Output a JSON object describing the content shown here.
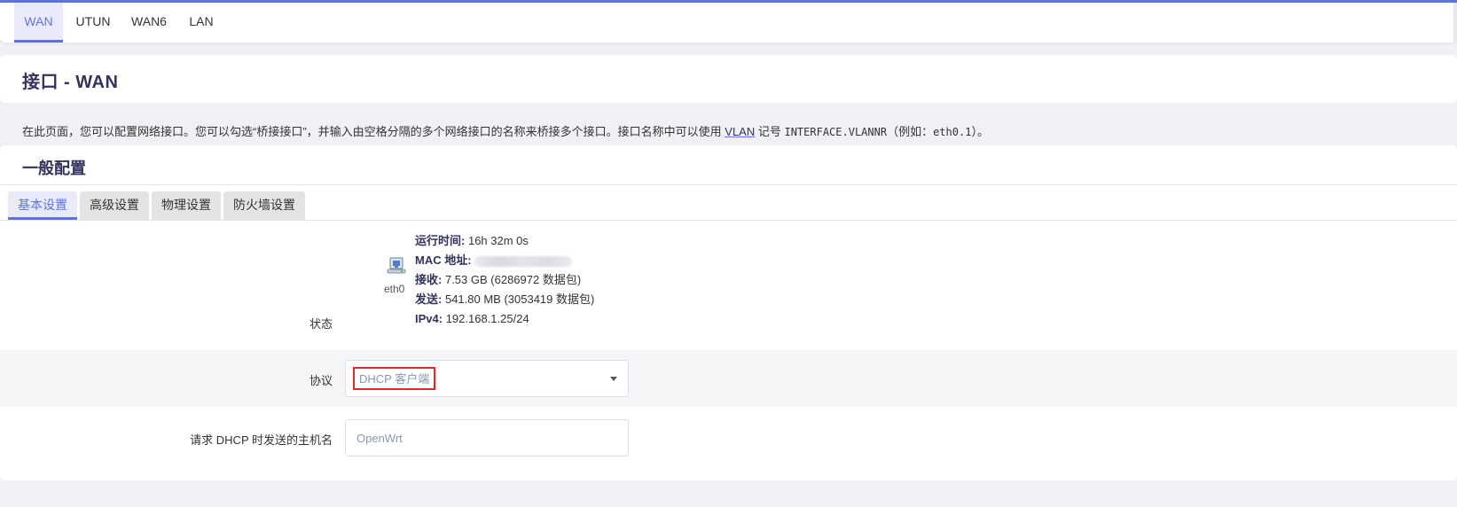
{
  "interface_tabs": [
    "WAN",
    "UTUN",
    "WAN6",
    "LAN"
  ],
  "active_interface_tab": "WAN",
  "page": {
    "title": "接口 - WAN",
    "description_prefix": "在此页面，您可以配置网络接口。您可以勾选“桥接接口”，并输入由空格分隔的多个网络接口的名称来桥接多个接口。接口名称中可以使用 ",
    "description_link": "VLAN",
    "description_mid": " 记号 ",
    "description_code": "INTERFACE.VLANNR",
    "description_example_prefix": "（例如：",
    "description_example_code": "eth0.1",
    "description_suffix": "）。"
  },
  "section": {
    "title": "一般配置",
    "tabs": [
      "基本设置",
      "高级设置",
      "物理设置",
      "防火墙设置"
    ],
    "active_tab": "基本设置"
  },
  "status": {
    "label": "状态",
    "interface_name": "eth0",
    "icon": "ethernet-port-icon",
    "uptime_label": "运行时间:",
    "uptime_value": "16h 32m 0s",
    "mac_label": "MAC 地址:",
    "rx_label": "接收:",
    "rx_value": "7.53 GB (6286972 数据包)",
    "tx_label": "发送:",
    "tx_value": "541.80 MB (3053419 数据包)",
    "ipv4_label": "IPv4:",
    "ipv4_value": "192.168.1.25/24"
  },
  "protocol": {
    "label": "协议",
    "selected": "DHCP 客户端"
  },
  "hostname": {
    "label": "请求 DHCP 时发送的主机名",
    "placeholder": "OpenWrt"
  },
  "colors": {
    "accent": "#5e72e4",
    "highlight_box": "#e8271b"
  }
}
